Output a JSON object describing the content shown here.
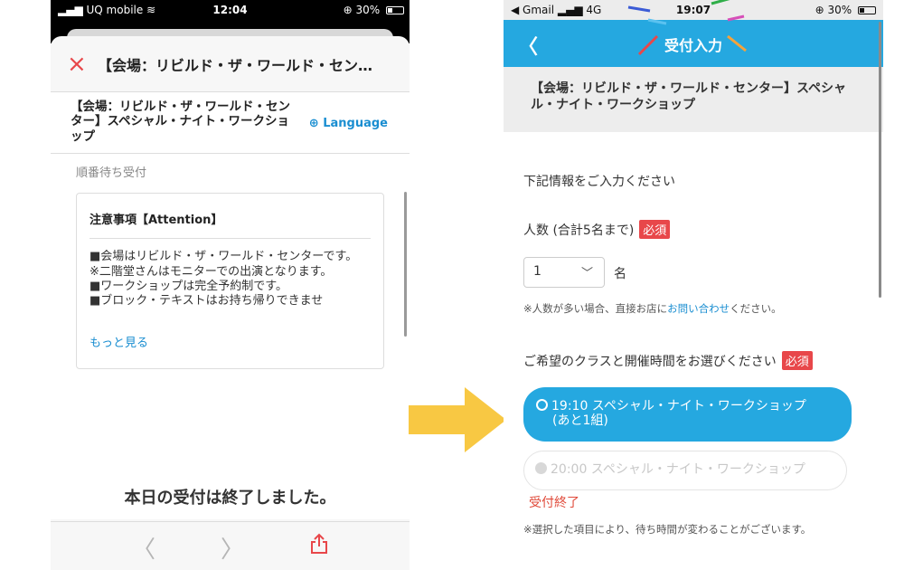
{
  "left_phone": {
    "status": {
      "carrier": "UQ mobile",
      "time": "12:04",
      "battery": "30%"
    },
    "nav": {
      "close_icon": "×",
      "title": "【会場：リビルド・ザ・ワールド・セン…"
    },
    "event_title": "【会場：リビルド・ザ・ワールド・センター】スペシャル・ナイト・ワークショップ",
    "language_label": "Language",
    "section_label": "順番待ち受付",
    "notice": {
      "title": "注意事項【Attention】",
      "lines": [
        "■会場はリビルド・ザ・ワールド・センターです。",
        "※二階堂さんはモニターでの出演となります。",
        "■ワークショップは完全予約制です。",
        "■ブロック・テキストはお持ち帰りできませ"
      ],
      "more_label": "もっと見る"
    },
    "closed_message": "本日の受付は終了しました。",
    "toolbar": {
      "back": "〈",
      "forward": "〉"
    }
  },
  "right_phone": {
    "status": {
      "carrier": "◀ Gmail",
      "network": "4G",
      "time": "19:07",
      "battery": "30%"
    },
    "header": {
      "back": "〈",
      "title": "受付入力"
    },
    "event_title": "【会場：リビルド・ザ・ワールド・センター】スペシャル・ナイト・ワークショップ",
    "intro": "下記情報をご入力ください",
    "count": {
      "label": "人数 (合計5名まで)",
      "required": "必須",
      "value": "1",
      "unit": "名",
      "note_prefix": "※人数が多い場合、直接お店に",
      "note_link": "お問い合わせ",
      "note_suffix": "ください。"
    },
    "slot": {
      "label": "ご希望のクラスと開催時間をお選びください",
      "required": "必須",
      "options": [
        {
          "line1": "19:10 スペシャル・ナイト・ワークショップ",
          "line2": "(あと1組)",
          "selected": true
        },
        {
          "line1": "20:00 スペシャル・ナイト・ワークショップ",
          "status": "受付終了",
          "disabled": true
        }
      ],
      "note": "※選択した項目により、待ち時間が変わることがございます。"
    }
  },
  "colors": {
    "accent": "#25a8e0",
    "required": "#e8474a",
    "link": "#1a8ed1",
    "arrow": "#f8c843"
  }
}
